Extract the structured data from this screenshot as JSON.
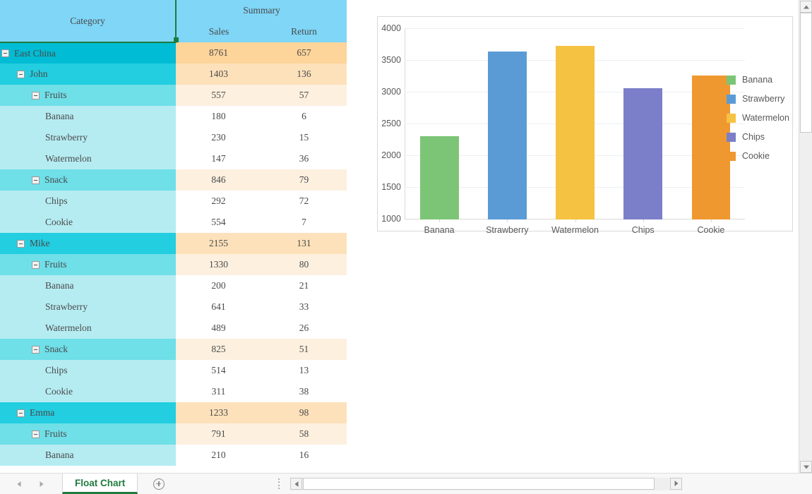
{
  "table": {
    "headers": {
      "category": "Category",
      "summary": "Summary",
      "sales": "Sales",
      "return": "Return"
    },
    "rows": [
      {
        "label": "East China",
        "level": 0,
        "expandable": true,
        "sales": "8761",
        "return": "657"
      },
      {
        "label": "John",
        "level": 1,
        "expandable": true,
        "sales": "1403",
        "return": "136"
      },
      {
        "label": "Fruits",
        "level": 2,
        "expandable": true,
        "sales": "557",
        "return": "57"
      },
      {
        "label": "Banana",
        "level": 3,
        "expandable": false,
        "sales": "180",
        "return": "6"
      },
      {
        "label": "Strawberry",
        "level": 3,
        "expandable": false,
        "sales": "230",
        "return": "15"
      },
      {
        "label": "Watermelon",
        "level": 3,
        "expandable": false,
        "sales": "147",
        "return": "36"
      },
      {
        "label": "Snack",
        "level": 2,
        "expandable": true,
        "sales": "846",
        "return": "79"
      },
      {
        "label": "Chips",
        "level": 3,
        "expandable": false,
        "sales": "292",
        "return": "72"
      },
      {
        "label": "Cookie",
        "level": 3,
        "expandable": false,
        "sales": "554",
        "return": "7"
      },
      {
        "label": "Mike",
        "level": 1,
        "expandable": true,
        "sales": "2155",
        "return": "131"
      },
      {
        "label": "Fruits",
        "level": 2,
        "expandable": true,
        "sales": "1330",
        "return": "80"
      },
      {
        "label": "Banana",
        "level": 3,
        "expandable": false,
        "sales": "200",
        "return": "21"
      },
      {
        "label": "Strawberry",
        "level": 3,
        "expandable": false,
        "sales": "641",
        "return": "33"
      },
      {
        "label": "Watermelon",
        "level": 3,
        "expandable": false,
        "sales": "489",
        "return": "26"
      },
      {
        "label": "Snack",
        "level": 2,
        "expandable": true,
        "sales": "825",
        "return": "51"
      },
      {
        "label": "Chips",
        "level": 3,
        "expandable": false,
        "sales": "514",
        "return": "13"
      },
      {
        "label": "Cookie",
        "level": 3,
        "expandable": false,
        "sales": "311",
        "return": "38"
      },
      {
        "label": "Emma",
        "level": 1,
        "expandable": true,
        "sales": "1233",
        "return": "98"
      },
      {
        "label": "Fruits",
        "level": 2,
        "expandable": true,
        "sales": "791",
        "return": "58"
      },
      {
        "label": "Banana",
        "level": 3,
        "expandable": false,
        "sales": "210",
        "return": "16"
      }
    ]
  },
  "chart_data": {
    "type": "bar",
    "title": "",
    "xlabel": "",
    "ylabel": "",
    "categories": [
      "Banana",
      "Strawberry",
      "Watermelon",
      "Chips",
      "Cookie"
    ],
    "values": [
      2310,
      3643,
      3738,
      3071,
      3262
    ],
    "colors": [
      "#7cc576",
      "#5b9bd5",
      "#f5c242",
      "#7b7fc9",
      "#ef9830"
    ],
    "ylim": [
      1000,
      4000
    ],
    "yticks": [
      1000,
      1500,
      2000,
      2500,
      3000,
      3500,
      4000
    ],
    "ytick_labels": [
      "1000",
      "1500",
      "2000",
      "2500",
      "3000",
      "3500",
      "4000"
    ],
    "grid": true,
    "legend_position": "right",
    "legend": [
      "Banana",
      "Strawberry",
      "Watermelon",
      "Chips",
      "Cookie"
    ]
  },
  "bottom": {
    "prev_sheet": "",
    "next_sheet": "",
    "sheet_tab": "Float Chart",
    "add_sheet": ""
  },
  "theme": {
    "accent_green": "#1e7b3c",
    "header_blue": "#7fd6f7",
    "level0": "#00bcd4",
    "level1": "#22cee0",
    "level2": "#6fdfe8",
    "level3": "#b5ecf2",
    "value0": "#fdd49a",
    "value1": "#fde1bb",
    "value2": "#fdf0df"
  }
}
